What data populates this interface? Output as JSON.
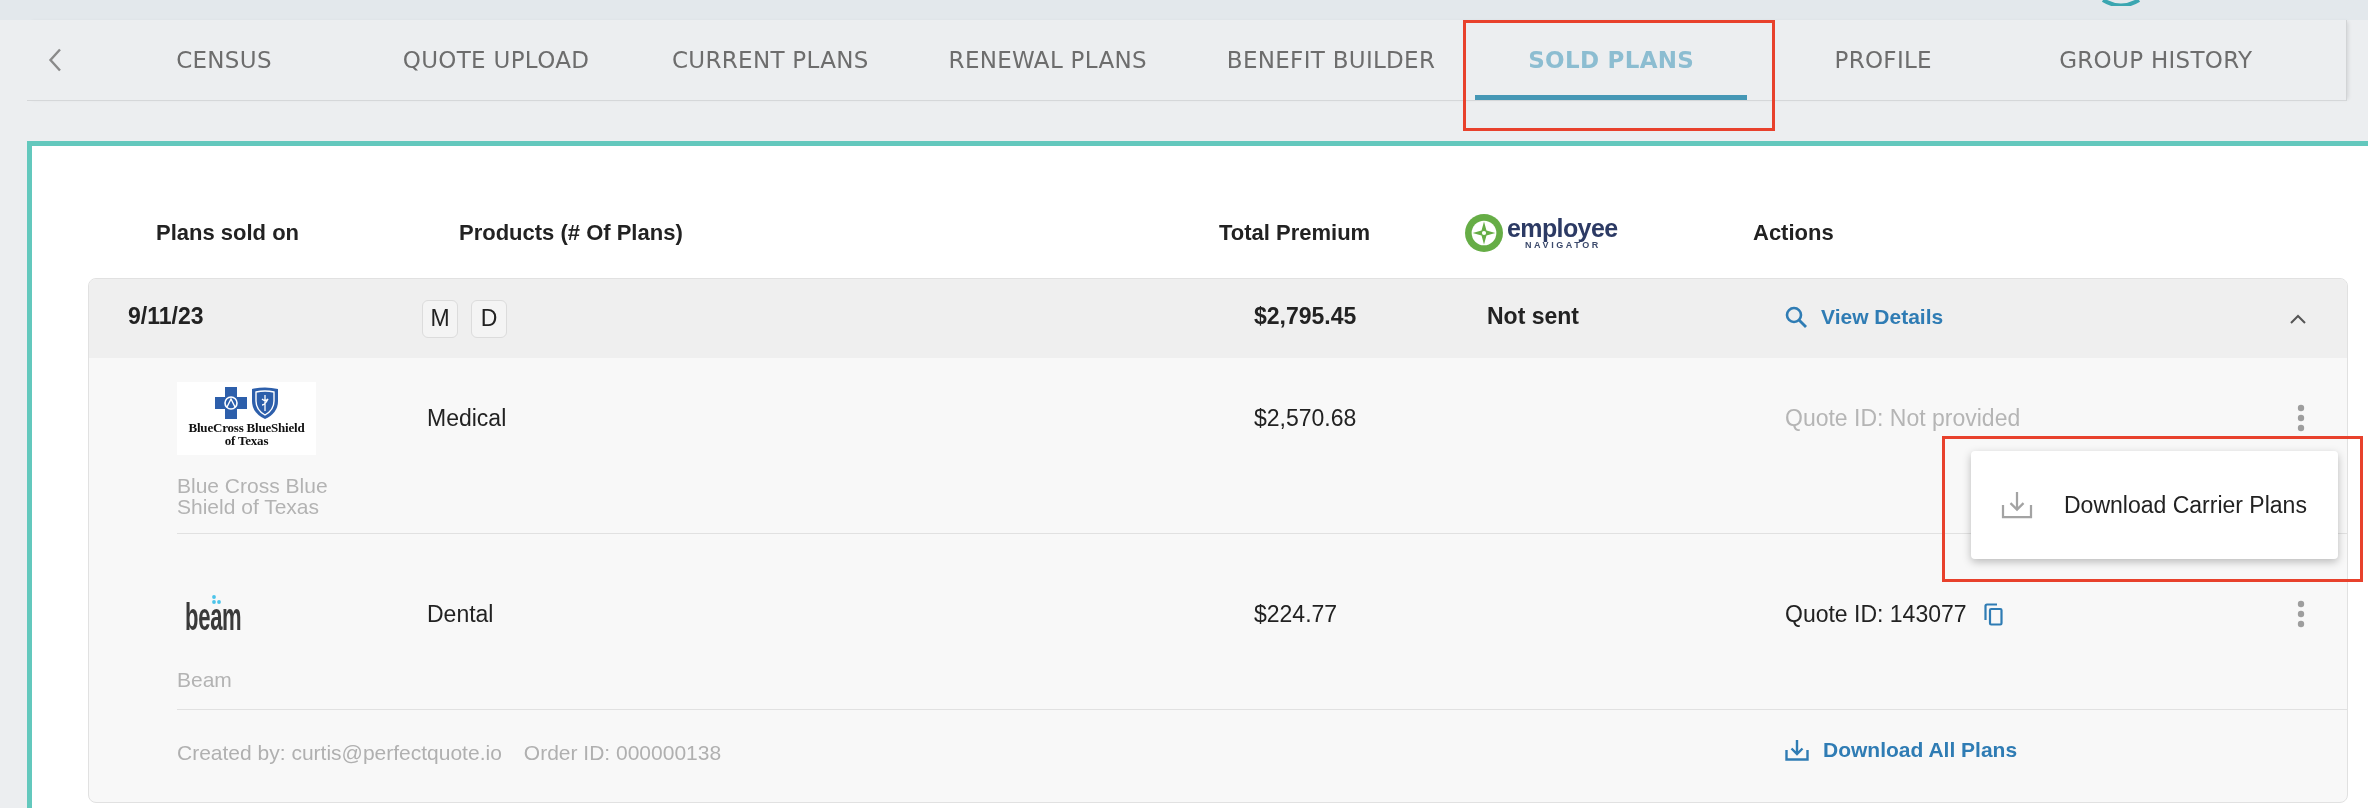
{
  "tab_bar": {
    "tabs": [
      {
        "label": "CENSUS",
        "selected": false,
        "highlighted": false
      },
      {
        "label": "QUOTE UPLOAD",
        "selected": false,
        "highlighted": false
      },
      {
        "label": "CURRENT PLANS",
        "selected": false,
        "highlighted": false
      },
      {
        "label": "RENEWAL PLANS",
        "selected": false,
        "highlighted": false
      },
      {
        "label": "BENEFIT BUILDER",
        "selected": false,
        "highlighted": false
      },
      {
        "label": "SOLD PLANS",
        "selected": true,
        "highlighted": true
      },
      {
        "label": "PROFILE",
        "selected": false,
        "highlighted": false
      },
      {
        "label": "GROUP HISTORY",
        "selected": false,
        "highlighted": false
      }
    ]
  },
  "table": {
    "columns": [
      {
        "kind": "text",
        "label": "Plans sold on"
      },
      {
        "kind": "text",
        "label": "Products (# Of Plans)"
      },
      {
        "kind": "text",
        "label": "Total Premium"
      },
      {
        "kind": "logo",
        "wordmark": "employee",
        "tagline": "NAVIGATOR"
      },
      {
        "kind": "text",
        "label": "Actions"
      }
    ],
    "orders": [
      {
        "date": "9/11/23",
        "products": [
          "M",
          "D"
        ],
        "total_premium": "$2,795.45",
        "status": "Not sent",
        "action": "View Details",
        "expanded": true,
        "plans": [
          {
            "logo": {
              "kind": "bcbs",
              "lines": [
                "BlueCross BlueShield",
                "of Texas"
              ]
            },
            "carrier": "Blue Cross Blue Shield of Texas",
            "product": "Medical",
            "premium": "$2,570.68",
            "quote_id": "Quote ID: Not provided",
            "muted": true,
            "copyable": false,
            "menu": {
              "highlighted": true,
              "items": [
                {
                  "label": "Download Carrier Plans"
                }
              ]
            }
          },
          {
            "logo": {
              "kind": "beam",
              "lines": [
                "beam"
              ]
            },
            "carrier": "Beam",
            "product": "Dental",
            "premium": "$224.77",
            "quote_id": "Quote ID: 143077",
            "muted": false,
            "copyable": true
          }
        ],
        "created_by": "Created by: curtis@perfectquote.io",
        "order_id": "Order ID: 000000138",
        "download_label": "Download All Plans"
      }
    ]
  }
}
